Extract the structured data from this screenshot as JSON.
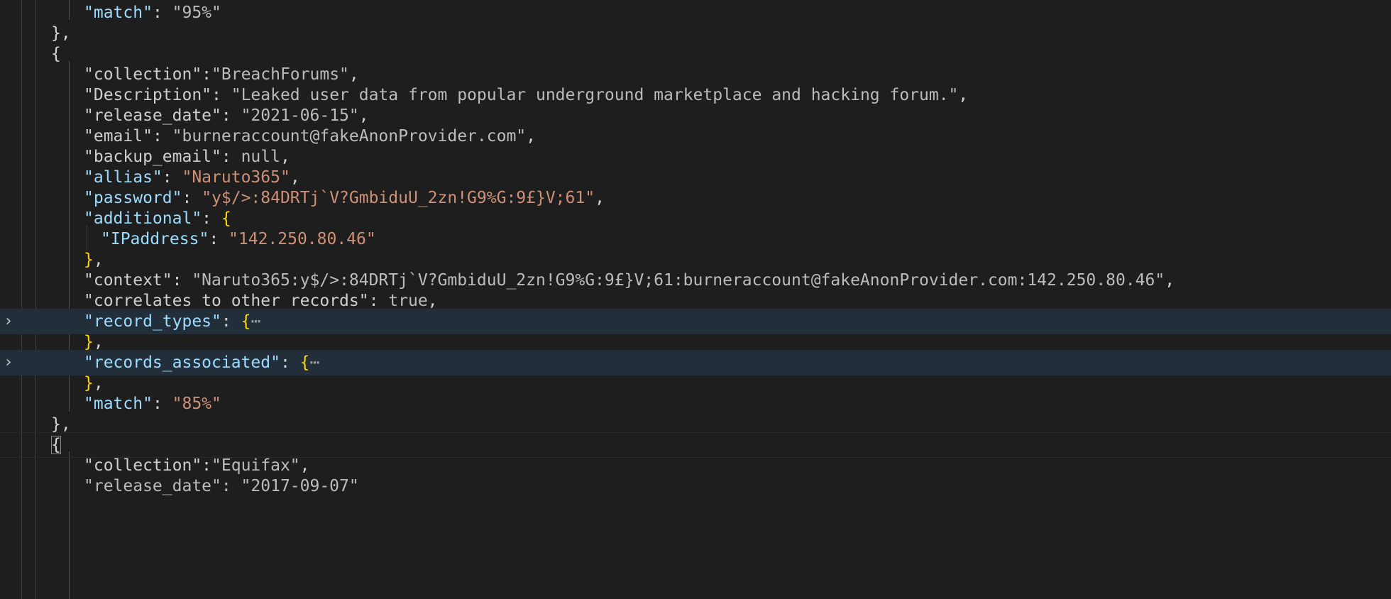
{
  "editor": {
    "records": {
      "prev_match_key": "\"match\"",
      "prev_match_value": "\"95%\"",
      "close_brace": "},",
      "open_brace": "{",
      "open_brace_plain": "{",
      "collection_key": "\"collection\"",
      "collection_value": "\"BreachForums\"",
      "description_key": "\"Description\"",
      "description_value": "\"Leaked user data from popular underground marketplace and hacking forum.\"",
      "release_date_key": "\"release_date\"",
      "release_date_value": "\"2021-06-15\"",
      "email_key": "\"email\"",
      "email_value": "\"burneraccount@fakeAnonProvider.com\"",
      "backup_email_key": "\"backup_email\"",
      "backup_email_value": "null",
      "allias_key": "\"allias\"",
      "allias_value": "\"Naruto365\"",
      "password_key": "\"password\"",
      "password_value": "\"y$/>:84DRTj`V?GmbiduU_2zn!G9%G:9£}V;61\"",
      "additional_key": "\"additional\"",
      "ipaddress_key": "\"IPaddress\"",
      "ipaddress_value": "\"142.250.80.46\"",
      "context_key": "\"context\"",
      "context_value": "\"Naruto365:y$/>:84DRTj`V?GmbiduU_2zn!G9%G:9£}V;61:burneraccount@fakeAnonProvider.com:142.250.80.46\"",
      "correlates_key": "\"correlates_to_other_records\"",
      "correlates_value": "true",
      "record_types_key": "\"record_types\"",
      "records_associated_key": "\"records_associated\"",
      "folded_ellipsis": "⋯",
      "match_key": "\"match\"",
      "match_value": "\"85%\"",
      "next_collection_key": "\"collection\"",
      "next_collection_value": "\"Equifax\"",
      "next_release_partial": "\"release_date\": \"2017-09-07\""
    },
    "fold_icons": {
      "record_types": "chevron-right-icon",
      "records_associated": "chevron-right-icon",
      "glyph": "›"
    },
    "colors": {
      "background": "#1e1e1e",
      "key": "#9cdcfe",
      "string": "#ce9178",
      "bracket": "#ffd700",
      "folded_line_highlight": "#222e3a"
    }
  }
}
